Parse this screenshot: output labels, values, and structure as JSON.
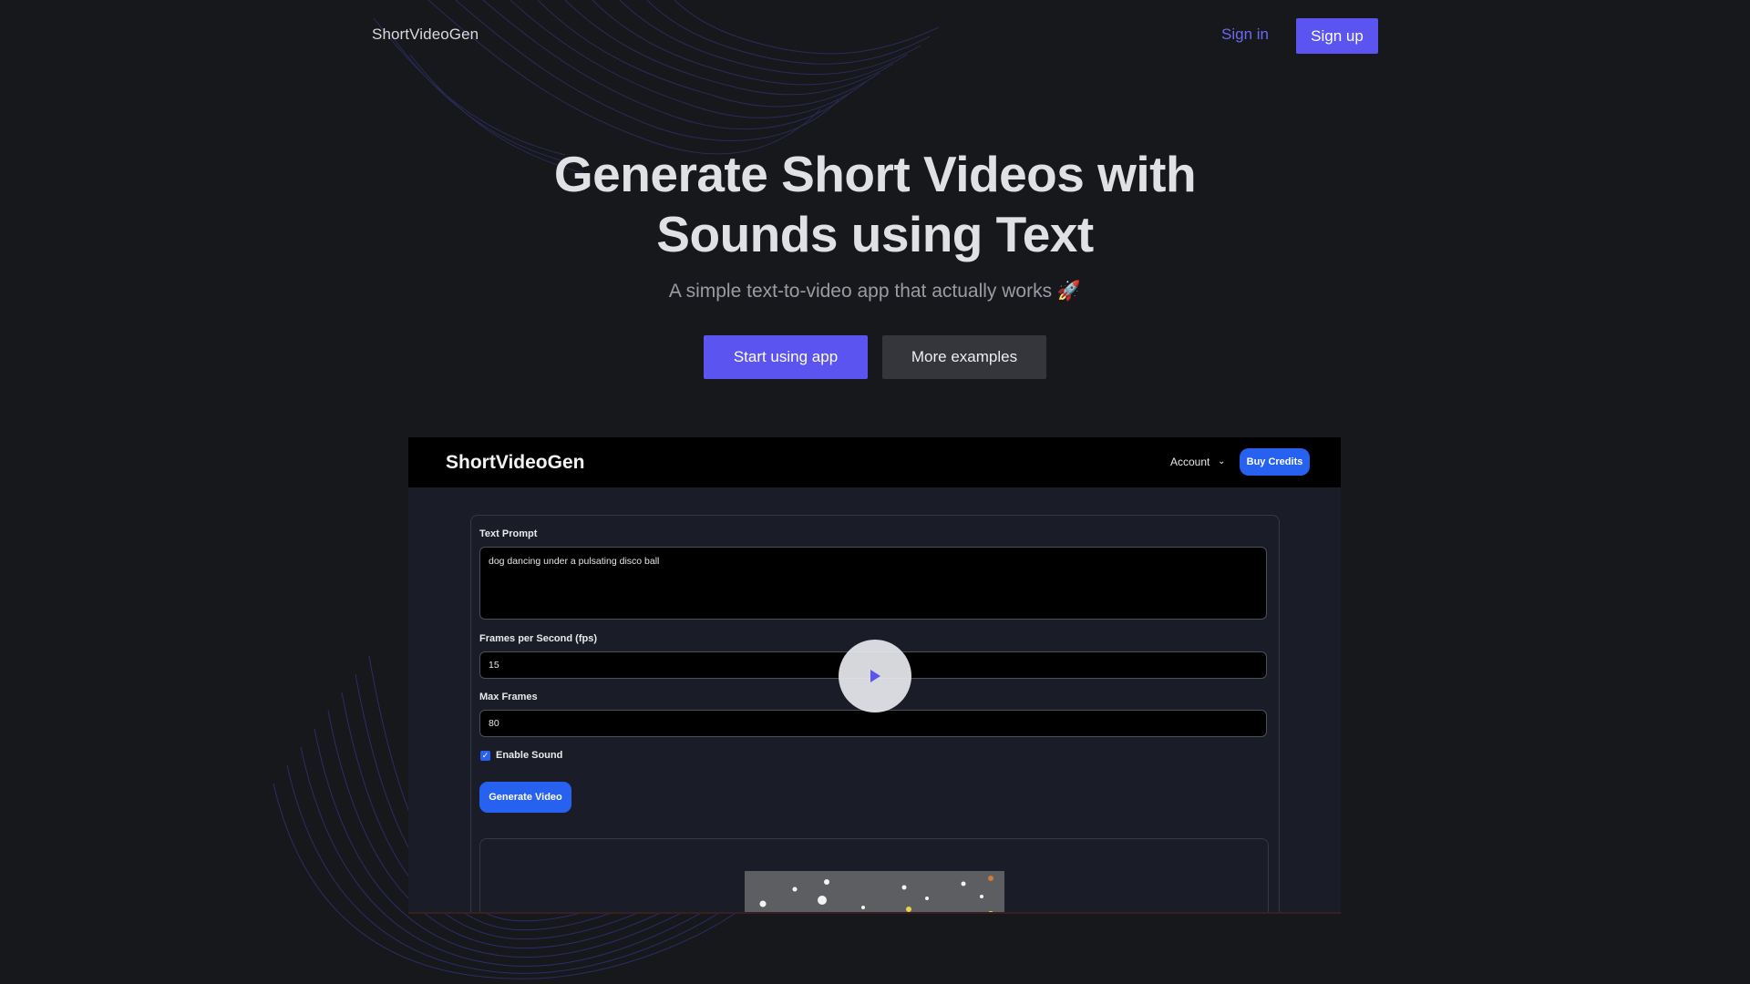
{
  "nav": {
    "brand": "ShortVideoGen",
    "sign_in": "Sign in",
    "sign_up": "Sign up"
  },
  "hero": {
    "title_line1": "Generate Short Videos with",
    "title_line2": "Sounds using Text",
    "subtitle": "A simple text-to-video app that actually works 🚀",
    "primary_cta": "Start using app",
    "secondary_cta": "More examples"
  },
  "preview": {
    "brand": "ShortVideoGen",
    "account": "Account",
    "buy_credits": "Buy Credits",
    "text_prompt_label": "Text Prompt",
    "text_prompt_value": "dog dancing under a pulsating disco ball",
    "fps_label": "Frames per Second (fps)",
    "fps_value": "15",
    "max_frames_label": "Max Frames",
    "max_frames_value": "80",
    "enable_sound_label": "Enable Sound",
    "enable_sound_checked": true,
    "generate_button": "Generate Video"
  },
  "colors": {
    "background": "#17181b",
    "accent": "#5b54f0",
    "preview_accent": "#2761f0",
    "secondary_button": "#34363b"
  },
  "icons": [
    "play-icon",
    "chevron-down-icon",
    "check-icon"
  ]
}
